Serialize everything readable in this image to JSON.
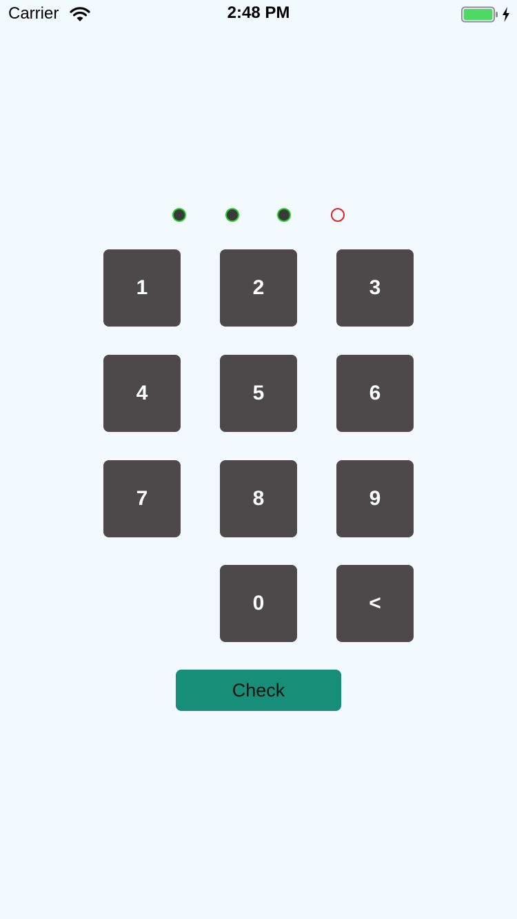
{
  "status_bar": {
    "carrier": "Carrier",
    "time": "2:48 PM",
    "wifi_icon": "wifi-icon",
    "battery_icon": "battery-full-icon",
    "charging_icon": "bolt-icon",
    "battery_color": "#4CD964"
  },
  "pin": {
    "length": 4,
    "filled_count": 3,
    "filled_fill": "#3A3A3A",
    "filled_border": "#22CC22",
    "empty_border": "#E02020"
  },
  "keypad": {
    "key_color": "#4D494A",
    "key_text_color": "#FFFFFF",
    "keys": [
      {
        "label": "1"
      },
      {
        "label": "2"
      },
      {
        "label": "3"
      },
      {
        "label": "4"
      },
      {
        "label": "5"
      },
      {
        "label": "6"
      },
      {
        "label": "7"
      },
      {
        "label": "8"
      },
      {
        "label": "9"
      },
      {
        "label": "0"
      },
      {
        "label": "<"
      }
    ]
  },
  "check_button": {
    "label": "Check",
    "color": "#178E77"
  },
  "background": "#F3FAFF"
}
